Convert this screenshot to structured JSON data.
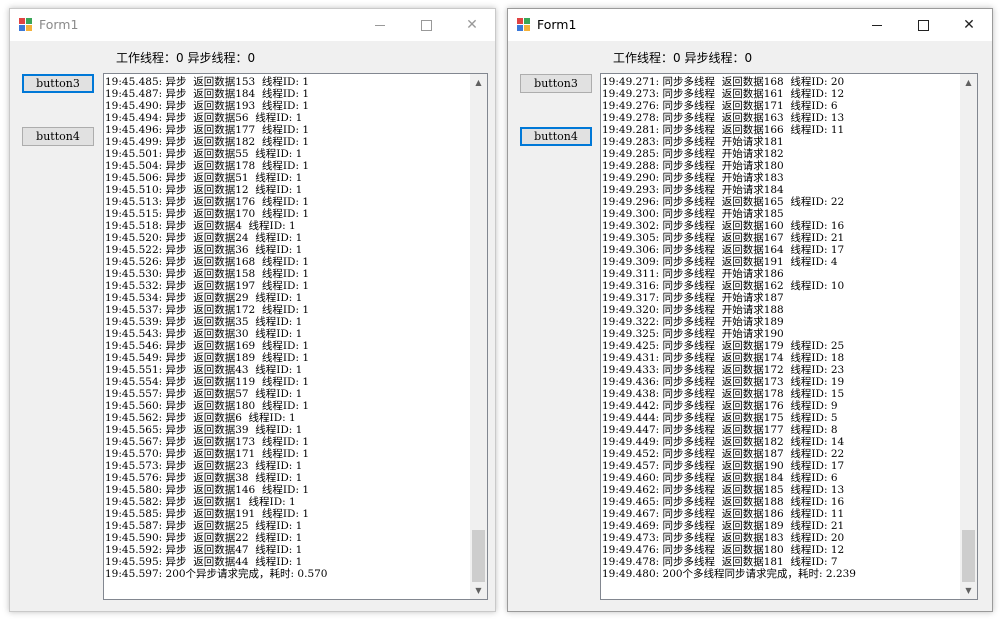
{
  "windows": [
    {
      "title": "Form1",
      "status": "工作线程：0 异步线程：0",
      "buttons": {
        "button3": "button3",
        "button4": "button4"
      },
      "log": [
        "19:45.485: 异步  返回数据153  线程ID: 1",
        "19:45.487: 异步  返回数据184  线程ID: 1",
        "19:45.490: 异步  返回数据193  线程ID: 1",
        "19:45.494: 异步  返回数据56  线程ID: 1",
        "19:45.496: 异步  返回数据177  线程ID: 1",
        "19:45.499: 异步  返回数据182  线程ID: 1",
        "19:45.501: 异步  返回数据55  线程ID: 1",
        "19:45.504: 异步  返回数据178  线程ID: 1",
        "19:45.506: 异步  返回数据51  线程ID: 1",
        "19:45.510: 异步  返回数据12  线程ID: 1",
        "19:45.513: 异步  返回数据176  线程ID: 1",
        "19:45.515: 异步  返回数据170  线程ID: 1",
        "19:45.518: 异步  返回数据4  线程ID: 1",
        "19:45.520: 异步  返回数据24  线程ID: 1",
        "19:45.522: 异步  返回数据36  线程ID: 1",
        "19:45.526: 异步  返回数据168  线程ID: 1",
        "19:45.530: 异步  返回数据158  线程ID: 1",
        "19:45.532: 异步  返回数据197  线程ID: 1",
        "19:45.534: 异步  返回数据29  线程ID: 1",
        "19:45.537: 异步  返回数据172  线程ID: 1",
        "19:45.539: 异步  返回数据35  线程ID: 1",
        "19:45.543: 异步  返回数据30  线程ID: 1",
        "19:45.546: 异步  返回数据169  线程ID: 1",
        "19:45.549: 异步  返回数据189  线程ID: 1",
        "19:45.551: 异步  返回数据43  线程ID: 1",
        "19:45.554: 异步  返回数据119  线程ID: 1",
        "19:45.557: 异步  返回数据57  线程ID: 1",
        "19:45.560: 异步  返回数据180  线程ID: 1",
        "19:45.562: 异步  返回数据6  线程ID: 1",
        "19:45.565: 异步  返回数据39  线程ID: 1",
        "19:45.567: 异步  返回数据173  线程ID: 1",
        "19:45.570: 异步  返回数据171  线程ID: 1",
        "19:45.573: 异步  返回数据23  线程ID: 1",
        "19:45.576: 异步  返回数据38  线程ID: 1",
        "19:45.580: 异步  返回数据146  线程ID: 1",
        "19:45.582: 异步  返回数据1  线程ID: 1",
        "19:45.585: 异步  返回数据191  线程ID: 1",
        "19:45.587: 异步  返回数据25  线程ID: 1",
        "19:45.590: 异步  返回数据22  线程ID: 1",
        "19:45.592: 异步  返回数据47  线程ID: 1",
        "19:45.595: 异步  返回数据44  线程ID: 1",
        "19:45.597: 200个异步请求完成，耗时: 0.570"
      ]
    },
    {
      "title": "Form1",
      "status": "工作线程：0 异步线程：0",
      "buttons": {
        "button3": "button3",
        "button4": "button4"
      },
      "log": [
        "19:49.271: 同步多线程  返回数据168  线程ID: 20",
        "19:49.273: 同步多线程  返回数据161  线程ID: 12",
        "19:49.276: 同步多线程  返回数据171  线程ID: 6",
        "19:49.278: 同步多线程  返回数据163  线程ID: 13",
        "19:49.281: 同步多线程  返回数据166  线程ID: 11",
        "19:49.283: 同步多线程  开始请求181",
        "19:49.285: 同步多线程  开始请求182",
        "19:49.288: 同步多线程  开始请求180",
        "19:49.290: 同步多线程  开始请求183",
        "19:49.293: 同步多线程  开始请求184",
        "19:49.296: 同步多线程  返回数据165  线程ID: 22",
        "19:49.300: 同步多线程  开始请求185",
        "19:49.302: 同步多线程  返回数据160  线程ID: 16",
        "19:49.305: 同步多线程  返回数据167  线程ID: 21",
        "19:49.306: 同步多线程  返回数据164  线程ID: 17",
        "19:49.309: 同步多线程  返回数据191  线程ID: 4",
        "19:49.311: 同步多线程  开始请求186",
        "19:49.316: 同步多线程  返回数据162  线程ID: 10",
        "19:49.317: 同步多线程  开始请求187",
        "19:49.320: 同步多线程  开始请求188",
        "19:49.322: 同步多线程  开始请求189",
        "19:49.325: 同步多线程  开始请求190",
        "19:49.425: 同步多线程  返回数据179  线程ID: 25",
        "19:49.431: 同步多线程  返回数据174  线程ID: 18",
        "19:49.433: 同步多线程  返回数据172  线程ID: 23",
        "19:49.436: 同步多线程  返回数据173  线程ID: 19",
        "19:49.438: 同步多线程  返回数据178  线程ID: 15",
        "19:49.442: 同步多线程  返回数据176  线程ID: 9",
        "19:49.444: 同步多线程  返回数据175  线程ID: 5",
        "19:49.447: 同步多线程  返回数据177  线程ID: 8",
        "19:49.449: 同步多线程  返回数据182  线程ID: 14",
        "19:49.452: 同步多线程  返回数据187  线程ID: 22",
        "19:49.457: 同步多线程  返回数据190  线程ID: 17",
        "19:49.460: 同步多线程  返回数据184  线程ID: 6",
        "19:49.462: 同步多线程  返回数据185  线程ID: 13",
        "19:49.465: 同步多线程  返回数据188  线程ID: 16",
        "19:49.467: 同步多线程  返回数据186  线程ID: 11",
        "19:49.469: 同步多线程  返回数据189  线程ID: 21",
        "19:49.473: 同步多线程  返回数据183  线程ID: 20",
        "19:49.476: 同步多线程  返回数据180  线程ID: 12",
        "19:49.478: 同步多线程  返回数据181  线程ID: 7",
        "19:49.480: 200个多线程同步请求完成，耗时: 2.239"
      ]
    }
  ],
  "colors": {
    "focus_border": "#0078d7",
    "window_bg": "#f0f0f0",
    "icon_red": "#e04343",
    "icon_green": "#3aa657",
    "icon_blue": "#3b78d8",
    "icon_yellow": "#f3b13a"
  },
  "icons": {
    "app": "form-app-icon",
    "minimize": "minimize-icon",
    "maximize": "maximize-icon",
    "close": "close-icon",
    "scroll_up": "scroll-up-arrow-icon",
    "scroll_down": "scroll-down-arrow-icon"
  }
}
